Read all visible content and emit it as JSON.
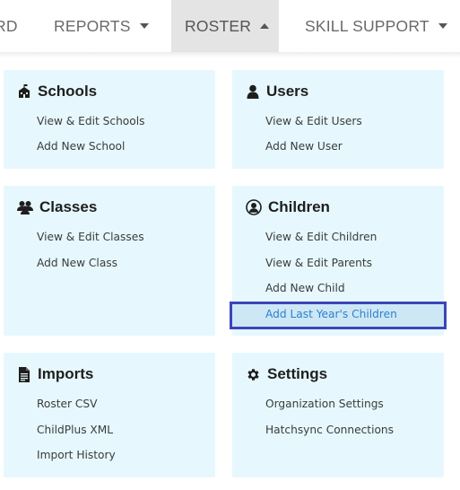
{
  "nav": {
    "item0": "RD",
    "item1": "REPORTS",
    "item2": "ROSTER",
    "item3": "SKILL SUPPORT"
  },
  "cards": {
    "schools": {
      "title": "Schools",
      "icon": "school-icon",
      "links": [
        "View & Edit Schools",
        "Add New School"
      ]
    },
    "users": {
      "title": "Users",
      "icon": "user-icon",
      "links": [
        "View & Edit Users",
        "Add New User"
      ]
    },
    "classes": {
      "title": "Classes",
      "icon": "group-icon",
      "links": [
        "View & Edit Classes",
        "Add New Class"
      ]
    },
    "children": {
      "title": "Children",
      "icon": "child-icon",
      "links": [
        "View & Edit Children",
        "View & Edit Parents",
        "Add New Child",
        "Add Last Year's Children"
      ]
    },
    "imports": {
      "title": "Imports",
      "icon": "document-icon",
      "links": [
        "Roster CSV",
        "ChildPlus XML",
        "Import History"
      ]
    },
    "settings": {
      "title": "Settings",
      "icon": "gear-icon",
      "links": [
        "Organization Settings",
        "Hatchsync Connections"
      ]
    }
  },
  "colors": {
    "card_bg": "#e6f8fd",
    "highlight_border": "#3c45b8",
    "highlight_bg": "#cde8f4",
    "link_highlight": "#2f7fd1",
    "active_tab_bg": "#e4e4e4"
  }
}
